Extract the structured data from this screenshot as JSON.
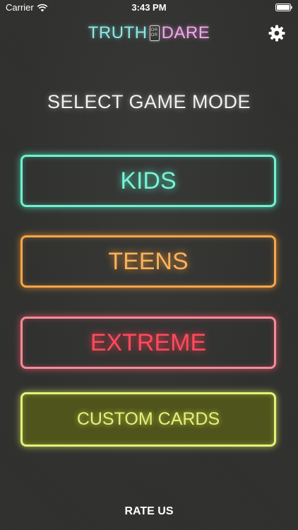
{
  "status_bar": {
    "carrier": "Carrier",
    "time": "3:43 PM",
    "wifi_icon": "wifi-icon",
    "battery_icon": "battery-icon"
  },
  "header": {
    "logo_truth": "TRUTH",
    "logo_or_top": "OR",
    "logo_or_bottom": "OR",
    "logo_dare": "DARE",
    "settings_icon": "gear-icon"
  },
  "title": "SELECT GAME MODE",
  "modes": [
    {
      "label": "KIDS",
      "color": "#6ff2d0"
    },
    {
      "label": "TEENS",
      "color": "#f6a64a"
    },
    {
      "label": "EXTREME",
      "color": "#ff4a5c"
    },
    {
      "label": "CUSTOM CARDS",
      "color": "#e3f07a"
    }
  ],
  "footer": {
    "rate_us": "RATE US"
  },
  "colors": {
    "background": "#30312f",
    "logo_truth": "#8ee8e4",
    "logo_dare": "#f2a6ec"
  }
}
